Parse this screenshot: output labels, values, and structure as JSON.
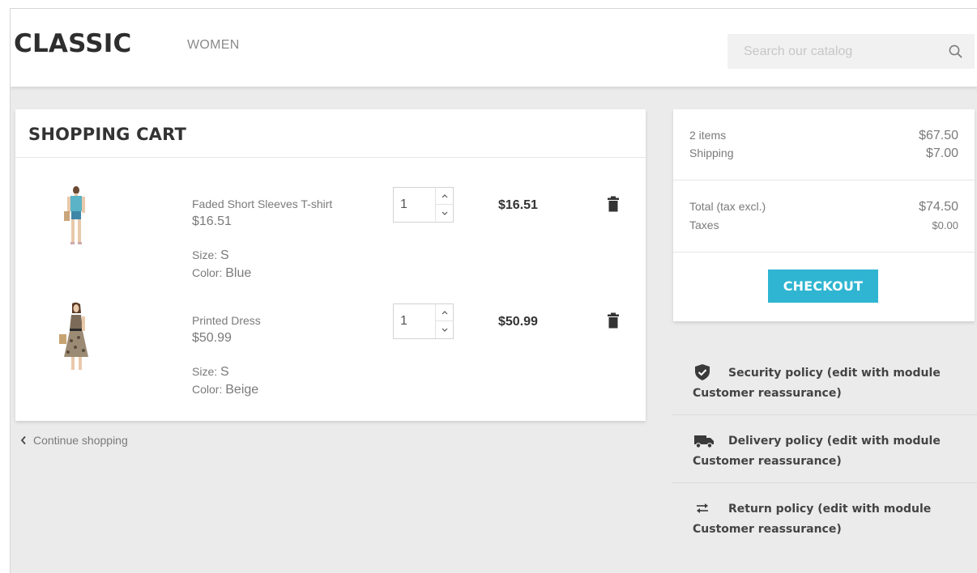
{
  "header": {
    "logo": "CLASSIC",
    "nav": [
      "WOMEN"
    ],
    "search_placeholder": "Search our catalog"
  },
  "cart": {
    "title": "SHOPPING CART",
    "items": [
      {
        "name": "Faded Short Sleeves T-shirt",
        "unit_price": "$16.51",
        "size_label": "Size:",
        "size": "S",
        "color_label": "Color:",
        "color": "Blue",
        "quantity": "1",
        "total": "$16.51"
      },
      {
        "name": "Printed Dress",
        "unit_price": "$50.99",
        "size_label": "Size:",
        "size": "S",
        "color_label": "Color:",
        "color": "Beige",
        "quantity": "1",
        "total": "$50.99"
      }
    ],
    "continue_label": "Continue shopping"
  },
  "summary": {
    "items_label": "2 items",
    "items_value": "$67.50",
    "shipping_label": "Shipping",
    "shipping_value": "$7.00",
    "total_label": "Total (tax excl.)",
    "total_value": "$74.50",
    "taxes_label": "Taxes",
    "taxes_value": "$0.00",
    "checkout_label": "CHECKOUT",
    "accent_color": "#2fb5d2"
  },
  "reassurance": [
    {
      "icon": "shield-check-icon",
      "text": "Security policy (edit with module Customer reassurance)"
    },
    {
      "icon": "truck-icon",
      "text": "Delivery policy (edit with module Customer reassurance)"
    },
    {
      "icon": "swap-arrows-icon",
      "text": "Return policy (edit with module Customer reassurance)"
    }
  ]
}
